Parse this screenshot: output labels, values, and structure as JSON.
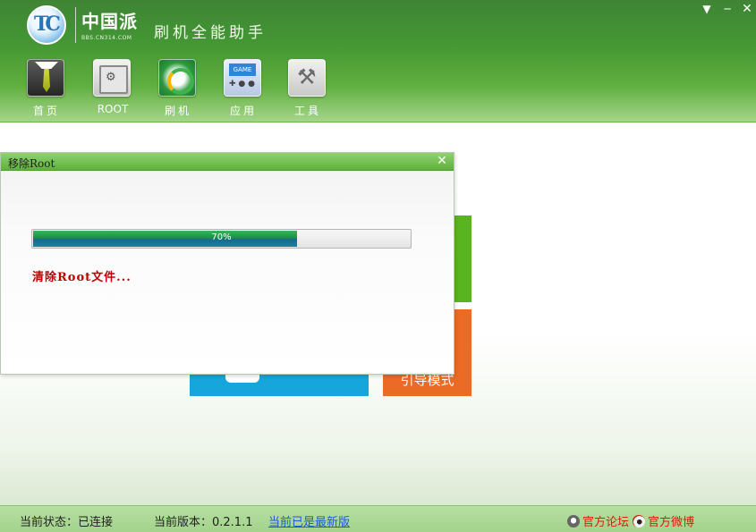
{
  "header": {
    "logo_text": "中国派",
    "logo_url": "BBS.CN314.COM",
    "app_title": "刷机全能助手"
  },
  "nav": [
    {
      "label": "首页",
      "icon": "suit-tie-icon"
    },
    {
      "label": "ROOT",
      "icon": "root-safe-icon"
    },
    {
      "label": "刷机",
      "icon": "flash-refresh-icon"
    },
    {
      "label": "应用",
      "icon": "game-console-icon"
    },
    {
      "label": "工具",
      "icon": "tools-icon"
    }
  ],
  "tiles": {
    "orange_label": "引导模式"
  },
  "dialog": {
    "title": "移除Root",
    "progress": 70,
    "progress_text": "70%",
    "status": "清除Root文件..."
  },
  "statusbar": {
    "state": "当前状态：已连接",
    "version": "当前版本：0.2.1.1",
    "latest": "当前已是最新版",
    "forum": "官方论坛",
    "weibo": "官方微博"
  },
  "colors": {
    "header_green": "#3f9230",
    "tile_green": "#5ab41f",
    "tile_orange": "#ea6a26",
    "tile_blue": "#16a6dc",
    "status_red": "#c00000",
    "link_blue": "#1a5bd6"
  }
}
